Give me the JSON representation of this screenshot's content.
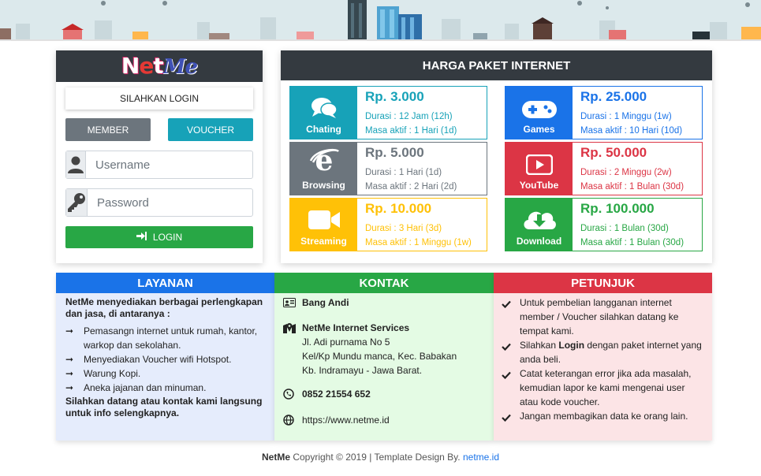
{
  "login": {
    "label": "SILAHKAN LOGIN",
    "tab_member": "MEMBER",
    "tab_voucher": "VOUCHER",
    "username_placeholder": "Username",
    "password_placeholder": "Password",
    "login_button": "LOGIN",
    "logo": {
      "n": "N",
      "e": "e",
      "t": "t",
      "me": "Me"
    }
  },
  "price": {
    "title": "HARGA PAKET INTERNET",
    "packages": [
      {
        "name": "Chating",
        "price": "Rp. 3.000",
        "duration": "Durasi : 12 Jam (12h)",
        "active": "Masa aktif : 1 Hari (1d)",
        "color": "#17a2b8",
        "icon": "chat-icon"
      },
      {
        "name": "Games",
        "price": "Rp. 25.000",
        "duration": "Durasi : 1 Minggu (1w)",
        "active": "Masa aktif : 10 Hari (10d)",
        "color": "#1a73e8",
        "icon": "gamepad-icon"
      },
      {
        "name": "Browsing",
        "price": "Rp. 5.000",
        "duration": "Durasi : 1 Hari (1d)",
        "active": "Masa aktif : 2 Hari (2d)",
        "color": "#6c757d",
        "icon": "browser-icon"
      },
      {
        "name": "YouTube",
        "price": "Rp. 50.000",
        "duration": "Durasi : 2 Minggu (2w)",
        "active": "Masa aktif : 1 Bulan (30d)",
        "color": "#dc3545",
        "icon": "youtube-icon"
      },
      {
        "name": "Streaming",
        "price": "Rp. 10.000",
        "duration": "Durasi : 3 Hari (3d)",
        "active": "Masa aktif : 1 Minggu (1w)",
        "color": "#ffc107",
        "icon": "video-icon"
      },
      {
        "name": "Download",
        "price": "Rp. 100.000",
        "duration": "Durasi : 1 Bulan (30d)",
        "active": "Masa aktif : 1 Bulan (30d)",
        "color": "#28a745",
        "icon": "download-icon"
      }
    ]
  },
  "layanan": {
    "title": "LAYANAN",
    "intro": "NetMe menyediakan berbagai perlengkapan dan jasa, di antaranya :",
    "items": [
      "Pemasangn internet untuk rumah, kantor, warkop dan sekolahan.",
      "Menyediakan Voucher wifi Hotspot.",
      "Warung Kopi.",
      "Aneka jajanan dan minuman."
    ],
    "closing": "Silahkan datang atau kontak kami langsung untuk info selengkapnya."
  },
  "kontak": {
    "title": "KONTAK",
    "name": "Bang Andi",
    "company": "NetMe Internet Services",
    "address": [
      "Jl. Adi purnama No 5",
      "Kel/Kp Mundu manca, Kec. Babakan",
      "Kb. Indramayu - Jawa Barat."
    ],
    "phone": "0852 21554 652",
    "website": "https://www.netme.id"
  },
  "petunjuk": {
    "title": "PETUNJUK",
    "items": [
      {
        "pre": "Untuk pembelian langganan internet member / Voucher silahkan datang ke tempat kami.",
        "bold": "",
        "post": ""
      },
      {
        "pre": "Silahkan ",
        "bold": "Login",
        "post": " dengan paket internet yang anda beli."
      },
      {
        "pre": "Catat keterangan error jika ada masalah, kemudian lapor ke kami mengenai user atau kode voucher.",
        "bold": "",
        "post": ""
      },
      {
        "pre": "Jangan membagikan data ke orang lain.",
        "bold": "",
        "post": ""
      }
    ]
  },
  "footer": {
    "brand": "NetMe",
    "text": " Copyright © 2019 | Template Design By. ",
    "link": "netme.id"
  }
}
